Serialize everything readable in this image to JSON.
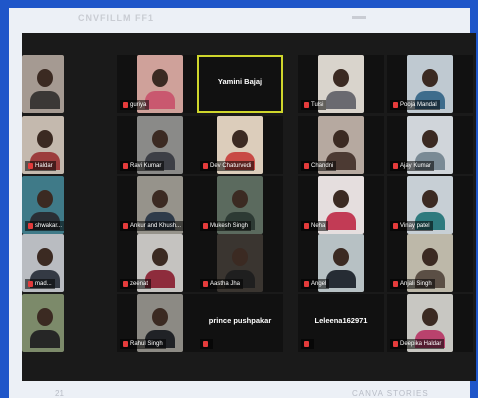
{
  "header": {
    "title": "CNVFILLM FF1"
  },
  "footer": {
    "left": "21",
    "right": "CANVA STORIES"
  },
  "participants": [
    {
      "name": "guriya",
      "video": true,
      "bg": "#cfa19a",
      "shirt": "#c9586f"
    },
    {
      "name": "Yamini Bajaj",
      "video": false,
      "highlight": true
    },
    {
      "name": "Tulsi",
      "video": true,
      "bg": "#d9d4cc",
      "shirt": "#6a6a70"
    },
    {
      "name": "Pooja Mandal",
      "video": true,
      "bg": "#bfc9d1",
      "shirt": "#3e6c8c"
    },
    {
      "name": "Ravi Kumar",
      "video": true,
      "bg": "#8a8a88",
      "shirt": "#3d3f46"
    },
    {
      "name": "Dev Chaturvedi",
      "video": true,
      "bg": "#dccdbb",
      "shirt": "#c84a45"
    },
    {
      "name": "Chandni",
      "video": true,
      "bg": "#b6a9a0",
      "shirt": "#4c3a33"
    },
    {
      "name": "Ajay Kumar",
      "video": true,
      "bg": "#d0d5da",
      "shirt": "#7a8a95"
    },
    {
      "name": "Ankur and Khush...",
      "video": true,
      "bg": "#96938b",
      "shirt": "#2f3b4a"
    },
    {
      "name": "Mukesh Singh",
      "video": true,
      "bg": "#5b6a5e",
      "shirt": "#2d3a34"
    },
    {
      "name": "Neha",
      "video": true,
      "bg": "#e5dede",
      "shirt": "#c23b55"
    },
    {
      "name": "Vinay patel",
      "video": true,
      "bg": "#c7cfd5",
      "shirt": "#2e7a7e"
    },
    {
      "name": "zeenat",
      "video": true,
      "bg": "#c5c3c0",
      "shirt": "#8e2c3c"
    },
    {
      "name": "Aastha Jha",
      "video": true,
      "bg": "#3a3530",
      "shirt": "#1f1f1f"
    },
    {
      "name": "Angel",
      "video": true,
      "bg": "#b7c1c4",
      "shirt": "#262c34"
    },
    {
      "name": "Anjali Singh",
      "video": true,
      "bg": "#bdb8a9",
      "shirt": "#5b4f45"
    },
    {
      "name": "Rahul Singh",
      "video": true,
      "bg": "#8c8a84",
      "shirt": "#202226"
    },
    {
      "name": "prince pushpakar",
      "video": false
    },
    {
      "name": "Leleena162971",
      "video": false
    },
    {
      "name": "Deepika Haldar",
      "video": true,
      "bg": "#c8c7c2",
      "shirt": "#b9426d"
    }
  ],
  "edge_left": [
    {
      "name": "",
      "bg": "#a59a92",
      "shirt": "#3b3836"
    },
    {
      "name": "Haldar",
      "bg": "#c4b9ae",
      "shirt": "#9c3d3d"
    },
    {
      "name": "shwakar...",
      "bg": "#3f7a88",
      "shirt": "#2a2f35"
    },
    {
      "name": "mad...",
      "bg": "#b9bcc1",
      "shirt": "#343a44"
    },
    {
      "name": "",
      "bg": "#7c8a6a",
      "shirt": "#262626"
    }
  ]
}
